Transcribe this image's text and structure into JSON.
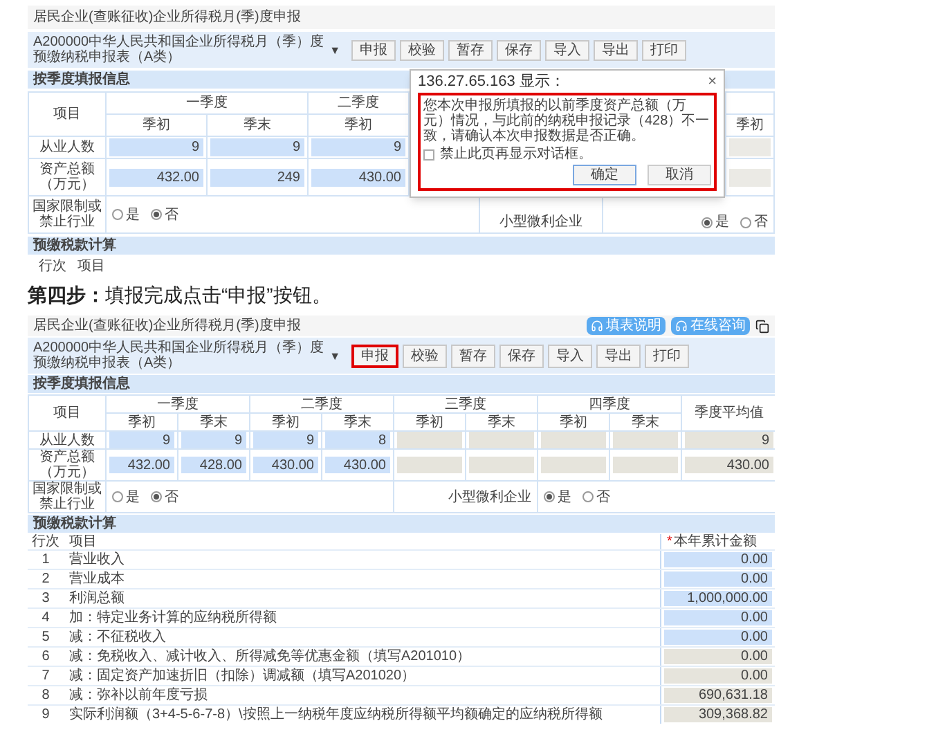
{
  "screenshot_1": {
    "title": "居民企业(查账征收)企业所得税月(季)度申报",
    "form_select": {
      "value": "A200000中华人民共和国企业所得税月（季）度预缴纳税申报表（A类）",
      "caret": "▼"
    },
    "buttons": [
      {
        "label": "申报",
        "highlighted": false
      },
      {
        "label": "校验",
        "highlighted": false
      },
      {
        "label": "暂存",
        "highlighted": false
      },
      {
        "label": "保存",
        "highlighted": false
      },
      {
        "label": "导入",
        "highlighted": false
      },
      {
        "label": "导出",
        "highlighted": false
      },
      {
        "label": "打印",
        "highlighted": false
      }
    ],
    "quarter_section": "按季度填报信息",
    "row_header": "项目",
    "quarter_headers": [
      "一季度",
      "二季度"
    ],
    "period_headers": [
      "季初",
      "季末",
      "季初"
    ],
    "edge_period_header": "季初",
    "rows": [
      {
        "label": "从业人数",
        "cells": [
          {
            "value": "9",
            "editable": true
          },
          {
            "value": "9",
            "editable": true
          },
          {
            "value": "9",
            "editable": true
          }
        ]
      },
      {
        "label": "资产总额（万元）",
        "cells": [
          {
            "value": "432.00",
            "editable": true
          },
          {
            "value": "249",
            "editable": true
          },
          {
            "value": "430.00",
            "editable": true
          }
        ]
      }
    ],
    "restricted_industry": {
      "label": "国家限制或禁止行业",
      "options": [
        {
          "label": "是",
          "selected": false
        },
        {
          "label": "否",
          "selected": true
        }
      ]
    },
    "small_enterprise": {
      "label": "小型微利企业",
      "options": [
        {
          "label": "是",
          "selected": true
        },
        {
          "label": "否",
          "selected": false
        }
      ]
    },
    "tax_section": "预缴税款计算",
    "tax_columns": {
      "line": "行次",
      "item": "项目"
    },
    "dialog": {
      "title": "136.27.65.163 显示：",
      "close": "×",
      "message": "您本次申报所填报的以前季度资产总额（万元）情况，与此前的纳税申报记录（428）不一致，请确认本次申报数据是否正确。",
      "checkbox": {
        "label": "禁止此页再显示对话框。",
        "checked": false
      },
      "buttons": [
        "确定",
        "取消"
      ],
      "highlighted": true
    }
  },
  "step_heading": "**第四步：**填报完成点击“申报”按钮。",
  "screenshot_2": {
    "title": "居民企业(查账征收)企业所得税月(季)度申报",
    "help_buttons": [
      "填表说明",
      "在线咨询"
    ],
    "form_select": {
      "value": "A200000中华人民共和国企业所得税月（季）度预缴纳税申报表（A类）",
      "caret": "▼"
    },
    "buttons": [
      {
        "label": "申报",
        "highlighted": true
      },
      {
        "label": "校验",
        "highlighted": false
      },
      {
        "label": "暂存",
        "highlighted": false
      },
      {
        "label": "保存",
        "highlighted": false
      },
      {
        "label": "导入",
        "highlighted": false
      },
      {
        "label": "导出",
        "highlighted": false
      },
      {
        "label": "打印",
        "highlighted": false
      }
    ],
    "quarter_section": "按季度填报信息",
    "row_header": "项目",
    "quarter_headers": [
      "一季度",
      "二季度",
      "三季度",
      "四季度"
    ],
    "average_header": "季度平均值",
    "period_headers": [
      "季初",
      "季末",
      "季初",
      "季末",
      "季初",
      "季末",
      "季初",
      "季末"
    ],
    "rows": [
      {
        "label": "从业人数",
        "cells": [
          {
            "value": "9",
            "editable": true
          },
          {
            "value": "9",
            "editable": true
          },
          {
            "value": "9",
            "editable": true
          },
          {
            "value": "8",
            "editable": true
          },
          {
            "editable": false
          },
          {
            "editable": false
          },
          {
            "editable": false
          },
          {
            "editable": false
          },
          {
            "value": "9",
            "editable": false
          }
        ]
      },
      {
        "label": "资产总额（万元）",
        "cells": [
          {
            "value": "432.00",
            "editable": true
          },
          {
            "value": "428.00",
            "editable": true
          },
          {
            "value": "430.00",
            "editable": true
          },
          {
            "value": "430.00",
            "editable": true
          },
          {
            "editable": false
          },
          {
            "editable": false
          },
          {
            "editable": false
          },
          {
            "editable": false
          },
          {
            "value": "430.00",
            "editable": false
          }
        ]
      }
    ],
    "restricted_industry": {
      "label": "国家限制或禁止行业",
      "options": [
        {
          "label": "是",
          "selected": false
        },
        {
          "label": "否",
          "selected": true
        }
      ]
    },
    "small_enterprise": {
      "label": "小型微利企业",
      "options": [
        {
          "label": "是",
          "selected": true
        },
        {
          "label": "否",
          "selected": false
        }
      ]
    },
    "tax_section": "预缴税款计算",
    "tax_columns": {
      "line": "行次",
      "item": "项目",
      "amount": "本年累计金额",
      "required_mark": "*"
    },
    "tax_rows": [
      {
        "line": "1",
        "item": "营业收入",
        "amount": "0.00",
        "editable": true
      },
      {
        "line": "2",
        "item": "营业成本",
        "amount": "0.00",
        "editable": true
      },
      {
        "line": "3",
        "item": "利润总额",
        "amount": "1,000,000.00",
        "editable": true
      },
      {
        "line": "4",
        "item": "加：特定业务计算的应纳税所得额",
        "amount": "0.00",
        "editable": true
      },
      {
        "line": "5",
        "item": "减：不征税收入",
        "amount": "0.00",
        "editable": true
      },
      {
        "line": "6",
        "item": "减：免税收入、减计收入、所得减免等优惠金额（填写A201010）",
        "amount": "0.00",
        "editable": false
      },
      {
        "line": "7",
        "item": "减：固定资产加速折旧（扣除）调减额（填写A201020）",
        "amount": "0.00",
        "editable": false
      },
      {
        "line": "8",
        "item": "减：弥补以前年度亏损",
        "amount": "690,631.18",
        "editable": false
      },
      {
        "line": "9",
        "item": "实际利润额（3+4-5-6-7-8）\\按照上一纳税年度应纳税所得额平均额确定的应纳税所得额",
        "amount": "309,368.82",
        "editable": false
      }
    ]
  }
}
